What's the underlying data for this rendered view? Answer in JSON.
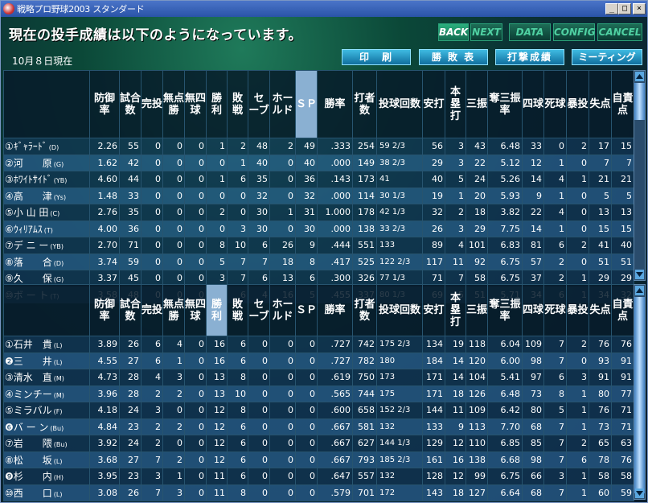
{
  "window": {
    "title": "戦略プロ野球2003 スタンダード",
    "minimize": "_",
    "maximize": "□",
    "close": "×"
  },
  "heading": "現在の投手成績は以下のようになっています。",
  "date_label": "10月８日現在",
  "nav": {
    "back": "BACK",
    "next": "NEXT",
    "data": "DATA",
    "config": "CONFIG",
    "cancel": "CANCEL"
  },
  "menu": {
    "print": "印　刷",
    "winloss": "勝 敗 表",
    "batting": "打撃成績",
    "meeting": "ミーティング"
  },
  "top_headers": [
    "防御率",
    "試合数",
    "完投",
    "無点勝",
    "無四球",
    "勝利",
    "敗戦",
    "セーブ",
    "ホールド",
    "ＳＰ",
    "勝率",
    "打者数",
    "投球回数",
    "安打",
    "本塁打",
    "三振",
    "奪三振率",
    "四球",
    "死球",
    "暴投",
    "失点",
    "自責点"
  ],
  "bottom_headers": [
    "防御率",
    "試合数",
    "完投",
    "無点勝",
    "無四球",
    "勝利",
    "敗戦",
    "セーブ",
    "ホールド",
    "ＳＰ",
    "勝率",
    "打者数",
    "投球回数",
    "安打",
    "本塁打",
    "三振",
    "奪三振率",
    "四球",
    "死球",
    "暴投",
    "失点",
    "自責点"
  ],
  "top_rows": [
    {
      "no": "①",
      "name": "ｷﾞｬﾗｰﾄﾞ",
      "team": "(D)",
      "v": [
        "2.26",
        "55",
        "0",
        "0",
        "0",
        "1",
        "2",
        "48",
        "2",
        "49",
        ".333",
        "254",
        "59 2/3",
        "56",
        "3",
        "43",
        "6.48",
        "33",
        "0",
        "2",
        "17",
        "15"
      ]
    },
    {
      "no": "②",
      "name": "河　　原",
      "team": "(G)",
      "v": [
        "1.62",
        "42",
        "0",
        "0",
        "0",
        "0",
        "1",
        "40",
        "0",
        "40",
        ".000",
        "149",
        "38 2/3",
        "29",
        "3",
        "22",
        "5.12",
        "12",
        "1",
        "0",
        "7",
        "7"
      ]
    },
    {
      "no": "③",
      "name": "ﾎﾜｲﾄｻｲﾄﾞ",
      "team": "(YB)",
      "v": [
        "4.60",
        "44",
        "0",
        "0",
        "0",
        "1",
        "6",
        "35",
        "0",
        "36",
        ".143",
        "173",
        "41",
        "40",
        "5",
        "24",
        "5.26",
        "14",
        "4",
        "1",
        "21",
        "21"
      ]
    },
    {
      "no": "④",
      "name": "高　　津",
      "team": "(Ys)",
      "v": [
        "1.48",
        "33",
        "0",
        "0",
        "0",
        "0",
        "0",
        "32",
        "0",
        "32",
        ".000",
        "114",
        "30 1/3",
        "19",
        "1",
        "20",
        "5.93",
        "9",
        "1",
        "0",
        "5",
        "5"
      ]
    },
    {
      "no": "⑤",
      "name": "小 山 田",
      "team": "(C)",
      "v": [
        "2.76",
        "35",
        "0",
        "0",
        "0",
        "2",
        "0",
        "30",
        "1",
        "31",
        "1.000",
        "178",
        "42 1/3",
        "32",
        "2",
        "18",
        "3.82",
        "22",
        "4",
        "0",
        "13",
        "13"
      ]
    },
    {
      "no": "⑥",
      "name": "ｳｨﾘｱﾑｽ",
      "team": "(T)",
      "v": [
        "4.00",
        "36",
        "0",
        "0",
        "0",
        "0",
        "3",
        "30",
        "0",
        "30",
        ".000",
        "138",
        "33 2/3",
        "26",
        "3",
        "29",
        "7.75",
        "14",
        "1",
        "0",
        "15",
        "15"
      ]
    },
    {
      "no": "⑦",
      "name": "デ ニ ー",
      "team": "(YB)",
      "v": [
        "2.70",
        "71",
        "0",
        "0",
        "0",
        "8",
        "10",
        "6",
        "26",
        "9",
        ".444",
        "551",
        "133",
        "89",
        "4",
        "101",
        "6.83",
        "81",
        "6",
        "2",
        "41",
        "40"
      ]
    },
    {
      "no": "⑧",
      "name": "落　　合",
      "team": "(D)",
      "v": [
        "3.74",
        "59",
        "0",
        "0",
        "0",
        "5",
        "7",
        "7",
        "18",
        "8",
        ".417",
        "525",
        "122 2/3",
        "117",
        "11",
        "92",
        "6.75",
        "57",
        "2",
        "0",
        "51",
        "51"
      ]
    },
    {
      "no": "⑨",
      "name": "久　　保",
      "team": "(G)",
      "v": [
        "3.37",
        "45",
        "0",
        "0",
        "0",
        "3",
        "7",
        "6",
        "13",
        "6",
        ".300",
        "326",
        "77 1/3",
        "71",
        "7",
        "58",
        "6.75",
        "37",
        "2",
        "1",
        "29",
        "29"
      ]
    },
    {
      "no": "⑩",
      "name": "ボ ー ト",
      "team": "(T)",
      "v": [
        "3.58",
        "48",
        "0",
        "0",
        "0",
        "5",
        "6",
        "4",
        "16",
        "5",
        ".455",
        "337",
        "80 1/3",
        "69",
        "5",
        "51",
        "5.71",
        "34",
        "6",
        "1",
        "34",
        "32"
      ]
    }
  ],
  "bottom_rows": [
    {
      "no": "①",
      "name": "石井　貴",
      "team": "(L)",
      "v": [
        "3.89",
        "26",
        "6",
        "4",
        "0",
        "16",
        "6",
        "0",
        "0",
        "0",
        ".727",
        "742",
        "175 2/3",
        "134",
        "19",
        "118",
        "6.04",
        "109",
        "7",
        "2",
        "76",
        "76"
      ]
    },
    {
      "no": "❷",
      "name": "三　　井",
      "team": "(L)",
      "v": [
        "4.55",
        "27",
        "6",
        "1",
        "0",
        "16",
        "6",
        "0",
        "0",
        "0",
        ".727",
        "782",
        "180",
        "184",
        "14",
        "120",
        "6.00",
        "98",
        "7",
        "0",
        "93",
        "91"
      ]
    },
    {
      "no": "③",
      "name": "清水　直",
      "team": "(M)",
      "v": [
        "4.73",
        "28",
        "4",
        "3",
        "0",
        "13",
        "8",
        "0",
        "0",
        "0",
        ".619",
        "750",
        "173",
        "171",
        "14",
        "104",
        "5.41",
        "97",
        "6",
        "3",
        "91",
        "91"
      ]
    },
    {
      "no": "④",
      "name": "ミンチー",
      "team": "(M)",
      "v": [
        "3.96",
        "28",
        "2",
        "2",
        "0",
        "13",
        "10",
        "0",
        "0",
        "0",
        ".565",
        "744",
        "175",
        "171",
        "18",
        "126",
        "6.48",
        "73",
        "8",
        "1",
        "80",
        "77"
      ]
    },
    {
      "no": "⑤",
      "name": "ミラバル",
      "team": "(F)",
      "v": [
        "4.18",
        "24",
        "3",
        "0",
        "0",
        "12",
        "8",
        "0",
        "0",
        "0",
        ".600",
        "658",
        "152 2/3",
        "144",
        "11",
        "109",
        "6.42",
        "80",
        "5",
        "1",
        "76",
        "71"
      ]
    },
    {
      "no": "❻",
      "name": "バ ー ン",
      "team": "(Bu)",
      "v": [
        "4.84",
        "23",
        "2",
        "2",
        "0",
        "12",
        "6",
        "0",
        "0",
        "0",
        ".667",
        "581",
        "132",
        "133",
        "9",
        "113",
        "7.70",
        "68",
        "7",
        "1",
        "73",
        "71"
      ]
    },
    {
      "no": "⑦",
      "name": "岩　　隈",
      "team": "(Bu)",
      "v": [
        "3.92",
        "24",
        "2",
        "0",
        "0",
        "12",
        "6",
        "0",
        "0",
        "0",
        ".667",
        "627",
        "144 1/3",
        "129",
        "12",
        "110",
        "6.85",
        "85",
        "7",
        "2",
        "65",
        "63"
      ]
    },
    {
      "no": "⑧",
      "name": "松　　坂",
      "team": "(L)",
      "v": [
        "3.68",
        "27",
        "7",
        "2",
        "0",
        "12",
        "6",
        "0",
        "0",
        "0",
        ".667",
        "793",
        "185 2/3",
        "161",
        "16",
        "138",
        "6.68",
        "98",
        "7",
        "6",
        "78",
        "76"
      ]
    },
    {
      "no": "❾",
      "name": "杉　　内",
      "team": "(H)",
      "v": [
        "3.95",
        "23",
        "3",
        "1",
        "0",
        "11",
        "6",
        "0",
        "0",
        "0",
        ".647",
        "557",
        "132",
        "128",
        "12",
        "99",
        "6.75",
        "66",
        "3",
        "1",
        "58",
        "58"
      ]
    },
    {
      "no": "⑩",
      "name": "西　　口",
      "team": "(L)",
      "v": [
        "3.08",
        "26",
        "7",
        "3",
        "0",
        "11",
        "8",
        "0",
        "0",
        "0",
        ".579",
        "701",
        "172",
        "143",
        "18",
        "127",
        "6.64",
        "68",
        "7",
        "1",
        "60",
        "59"
      ]
    }
  ],
  "highlight": {
    "top_column": 9,
    "bottom_column": 5
  }
}
